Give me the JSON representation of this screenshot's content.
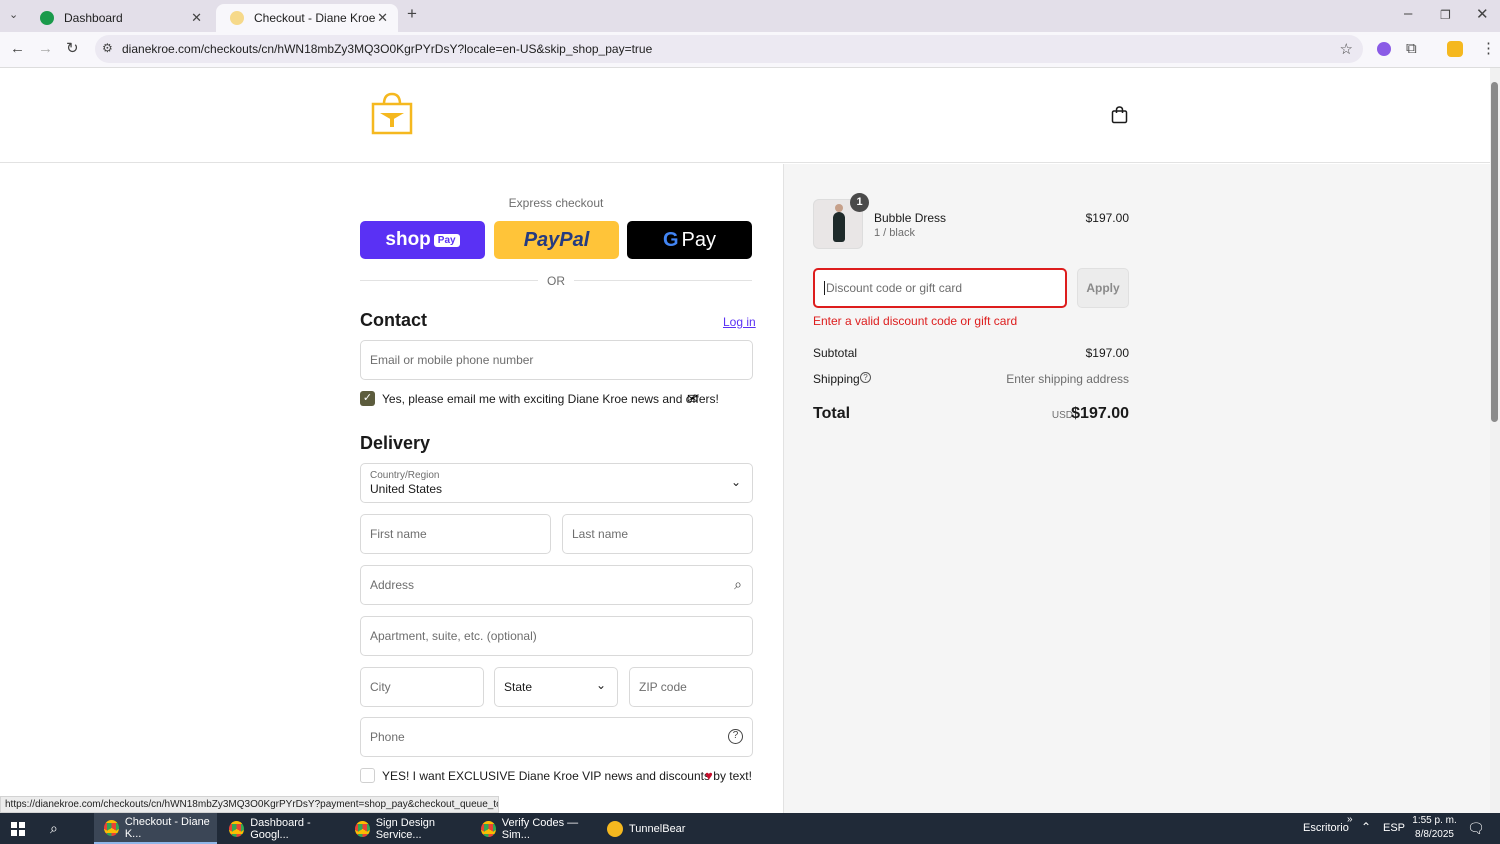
{
  "browser": {
    "tabs": [
      {
        "label": "Dashboard",
        "active": false
      },
      {
        "label": "Checkout - Diane Kroe",
        "active": true
      }
    ],
    "url": "dianekroe.com/checkouts/cn/hWN18mbZy3MQ3O0KgrPYrDsY?locale=en-US&skip_shop_pay=true",
    "status_url": "https://dianekroe.com/checkouts/cn/hWN18mbZy3MQ3O0KgrPYrDsY?payment=shop_pay&checkout_queue_token=..."
  },
  "checkout": {
    "express_label": "Express checkout",
    "shop_pay": {
      "text": "shop",
      "badge": "Pay"
    },
    "paypal": "PayPal",
    "gpay": "Pay",
    "or_label": "OR",
    "contact_title": "Contact",
    "login_link": "Log in",
    "email_placeholder": "Email or mobile phone number",
    "newsletter_label": "Yes, please email me with exciting Diane Kroe news and offers!",
    "delivery_title": "Delivery",
    "country_label": "Country/Region",
    "country_value": "United States",
    "first_name": "First name",
    "last_name": "Last name",
    "address": "Address",
    "apartment": "Apartment, suite, etc. (optional)",
    "city": "City",
    "state": "State",
    "zip": "ZIP code",
    "phone": "Phone",
    "sms_label": "YES! I want EXCLUSIVE Diane Kroe VIP news and discounts by text!"
  },
  "summary": {
    "item_name": "Bubble Dress",
    "item_variant": "1 / black",
    "item_qty": "1",
    "item_price": "$197.00",
    "discount_placeholder": "Discount code or gift card",
    "apply_label": "Apply",
    "discount_error": "Enter a valid discount code or gift card",
    "subtotal_label": "Subtotal",
    "subtotal_value": "$197.00",
    "shipping_label": "Shipping",
    "shipping_value": "Enter shipping address",
    "total_label": "Total",
    "currency": "USD",
    "total_value": "$197.00"
  },
  "taskbar": {
    "items": [
      "Checkout - Diane K...",
      "Dashboard - Googl...",
      "Sign Design Service...",
      "Verify Codes — Sim...",
      "TunnelBear"
    ],
    "desktop_label": "Escritorio",
    "lang": "ESP",
    "time": "1:55 p. m.",
    "date": "8/8/2025"
  },
  "colors": {
    "accent": "#5a31f4",
    "paypal": "#ffc439",
    "error": "#dd1d1d",
    "logo": "#f5b81f"
  }
}
